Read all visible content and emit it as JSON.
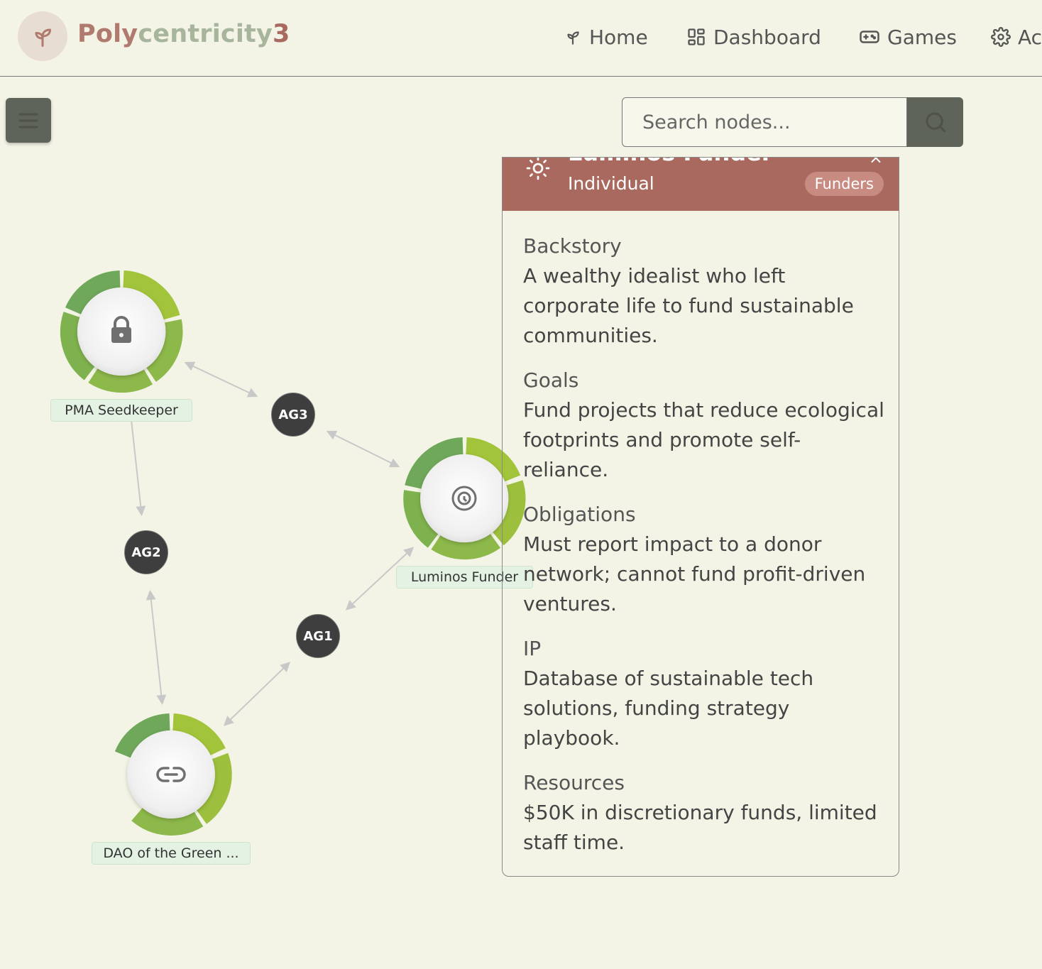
{
  "app": {
    "brand_part1": "Poly",
    "brand_part2": "centricity",
    "brand_part3": "3",
    "logo_icon": "sprout-icon"
  },
  "nav": {
    "home": "Home",
    "dashboard": "Dashboard",
    "games": "Games",
    "admin": "Ac"
  },
  "search": {
    "placeholder": "Search nodes..."
  },
  "graph": {
    "nodes": [
      {
        "id": "pma",
        "label": "PMA Seedkeeper",
        "icon": "lock-icon"
      },
      {
        "id": "luminos",
        "label": "Luminos Funder",
        "icon": "target-icon"
      },
      {
        "id": "dao",
        "label": "DAO of the Green ...",
        "icon": "link-icon"
      }
    ],
    "agreements": [
      {
        "label": "AG3"
      },
      {
        "label": "AG2"
      },
      {
        "label": "AG1"
      }
    ],
    "colors": {
      "ring_light": "#a2c43a",
      "ring_mid": "#8db84a",
      "ring_dark": "#6fa85a",
      "edge": "#c8c8c8"
    }
  },
  "detail": {
    "title": "Luminos Funder",
    "type": "Individual",
    "badge": "Funders",
    "header_color": "#a9695e",
    "close": "×",
    "sections": [
      {
        "title": "Backstory",
        "text": "A wealthy idealist who left corporate life to fund sustainable communities."
      },
      {
        "title": "Goals",
        "text": "Fund projects that reduce ecological footprints and promote self-reliance."
      },
      {
        "title": "Obligations",
        "text": "Must report impact to a donor network; cannot fund profit-driven ventures."
      },
      {
        "title": "IP",
        "text": "Database of sustainable tech solutions, funding strategy playbook."
      },
      {
        "title": "Resources",
        "text": "$50K in discretionary funds, limited staff time."
      }
    ]
  }
}
